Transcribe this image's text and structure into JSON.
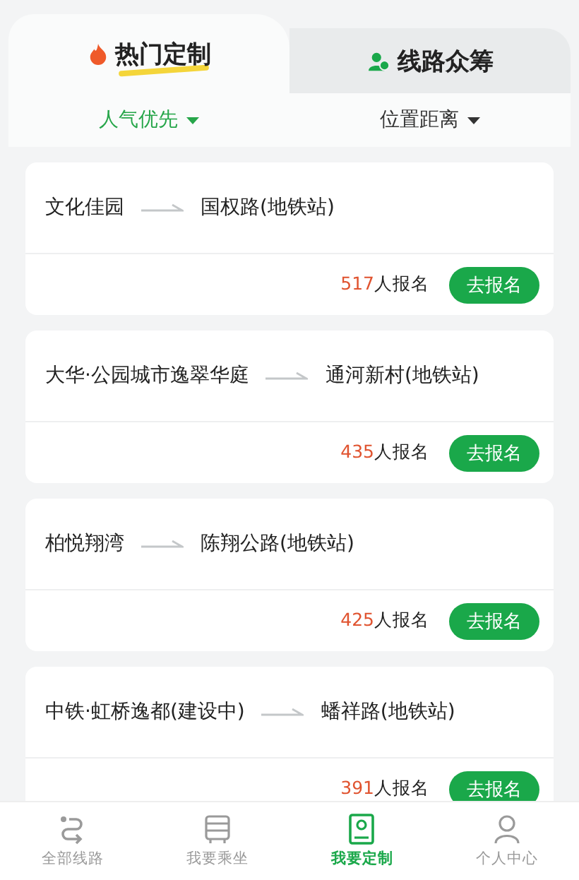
{
  "tabs": [
    {
      "label": "热门定制",
      "selected": true
    },
    {
      "label": "线路众筹",
      "selected": false
    }
  ],
  "filters": [
    {
      "label": "人气优先",
      "selected": true
    },
    {
      "label": "位置距离",
      "selected": false
    }
  ],
  "routes": [
    {
      "from": "文化佳园",
      "to": "国权路(地铁站)",
      "count": "517",
      "count_suffix": "人报名",
      "button": "去报名"
    },
    {
      "from": "大华·公园城市逸翠华庭",
      "to": "通河新村(地铁站)",
      "count": "435",
      "count_suffix": "人报名",
      "button": "去报名"
    },
    {
      "from": "柏悦翔湾",
      "to": "陈翔公路(地铁站)",
      "count": "425",
      "count_suffix": "人报名",
      "button": "去报名"
    },
    {
      "from": "中铁·虹桥逸都(建设中)",
      "to": "蟠祥路(地铁站)",
      "count": "391",
      "count_suffix": "人报名",
      "button": "去报名"
    }
  ],
  "nav": [
    {
      "label": "全部线路",
      "selected": false
    },
    {
      "label": "我要乘坐",
      "selected": false
    },
    {
      "label": "我要定制",
      "selected": true
    },
    {
      "label": "个人中心",
      "selected": false
    }
  ]
}
